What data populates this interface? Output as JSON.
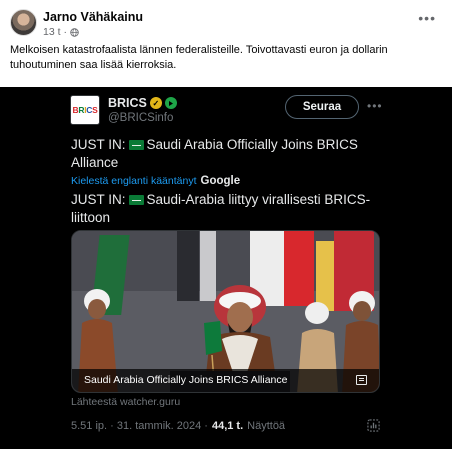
{
  "post": {
    "author": "Jarno Vähäkainu",
    "time": "13 t",
    "separator": "·",
    "text": "Melkoisen katastrofaalista lännen federalisteille. Toivottavasti euron ja dollarin tuhoutuminen saa lisää kierroksia.",
    "menu_icon": "more-horizontal-icon",
    "privacy_icon": "globe-icon"
  },
  "tweet": {
    "logo_text": [
      "B",
      "R",
      "I",
      "C",
      "S"
    ],
    "name": "BRICS",
    "handle": "@BRICSinfo",
    "follow_label": "Seuraa",
    "text_original_prefix": "JUST IN:",
    "text_original": "Saudi Arabia Officially Joins BRICS Alliance",
    "translate_label": "Kielestä englanti kääntänyt",
    "translate_provider": "Google",
    "text_translated_prefix": "JUST IN:",
    "text_translated": "Saudi-Arabia liittyy virallisesti BRICS-liittoon",
    "card_title": "Saudi Arabia Officially Joins BRICS Alliance",
    "source": "Lähteestä watcher.guru",
    "timestamp": "5.51 ip. · 31. tammik. 2024 ·",
    "views_count": "44,1 t.",
    "views_label": "Näyttöä"
  },
  "colors": {
    "x_background": "#000000",
    "x_link": "#1d9bf0",
    "x_muted": "#71767b",
    "verified_gold": "#e2b719",
    "affiliate_green": "#1ea548"
  }
}
